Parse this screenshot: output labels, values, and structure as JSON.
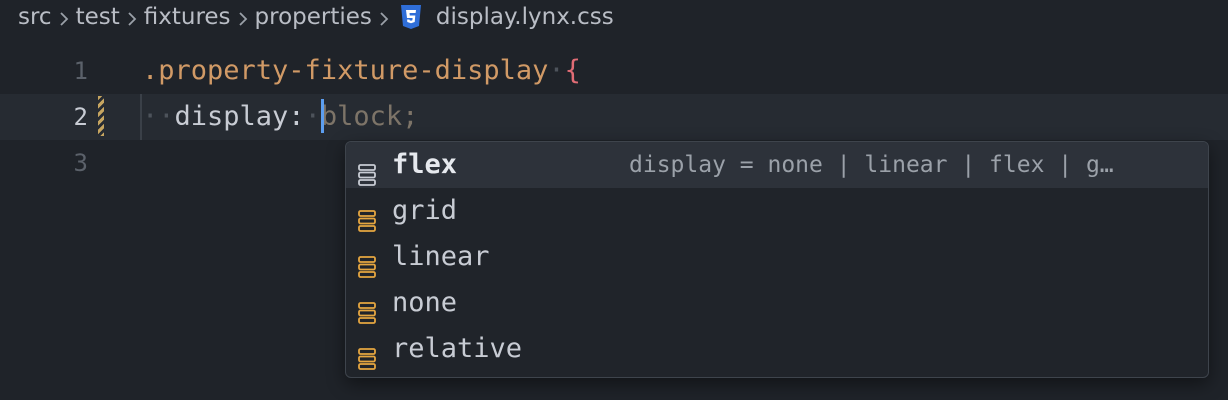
{
  "breadcrumb": {
    "segments": [
      "src",
      "test",
      "fixtures",
      "properties"
    ],
    "file_icon": "css3-icon",
    "file_name": "display.lynx.css"
  },
  "editor": {
    "lines": [
      {
        "number": "1",
        "selector": ".property-fixture-display",
        "brace": "{"
      },
      {
        "number": "2",
        "property": "display:",
        "value": "block;"
      },
      {
        "number": "3"
      }
    ]
  },
  "completion": {
    "items": [
      {
        "label": "flex",
        "detail": "display = none | linear | flex | g…",
        "icon": "enum-member-icon",
        "selected": true
      },
      {
        "label": "grid",
        "icon": "enum-member-icon"
      },
      {
        "label": "linear",
        "icon": "enum-member-icon"
      },
      {
        "label": "none",
        "icon": "enum-member-icon"
      },
      {
        "label": "relative",
        "icon": "enum-member-icon"
      }
    ]
  },
  "colors": {
    "background": "#1f2329",
    "selector": "#d19a66",
    "brace": "#e06c75",
    "cursor": "#5c9ef0",
    "enum_icon_selected": "#c8ccd4",
    "enum_icon": "#e5a640",
    "css_icon": "#2f6ed8"
  }
}
